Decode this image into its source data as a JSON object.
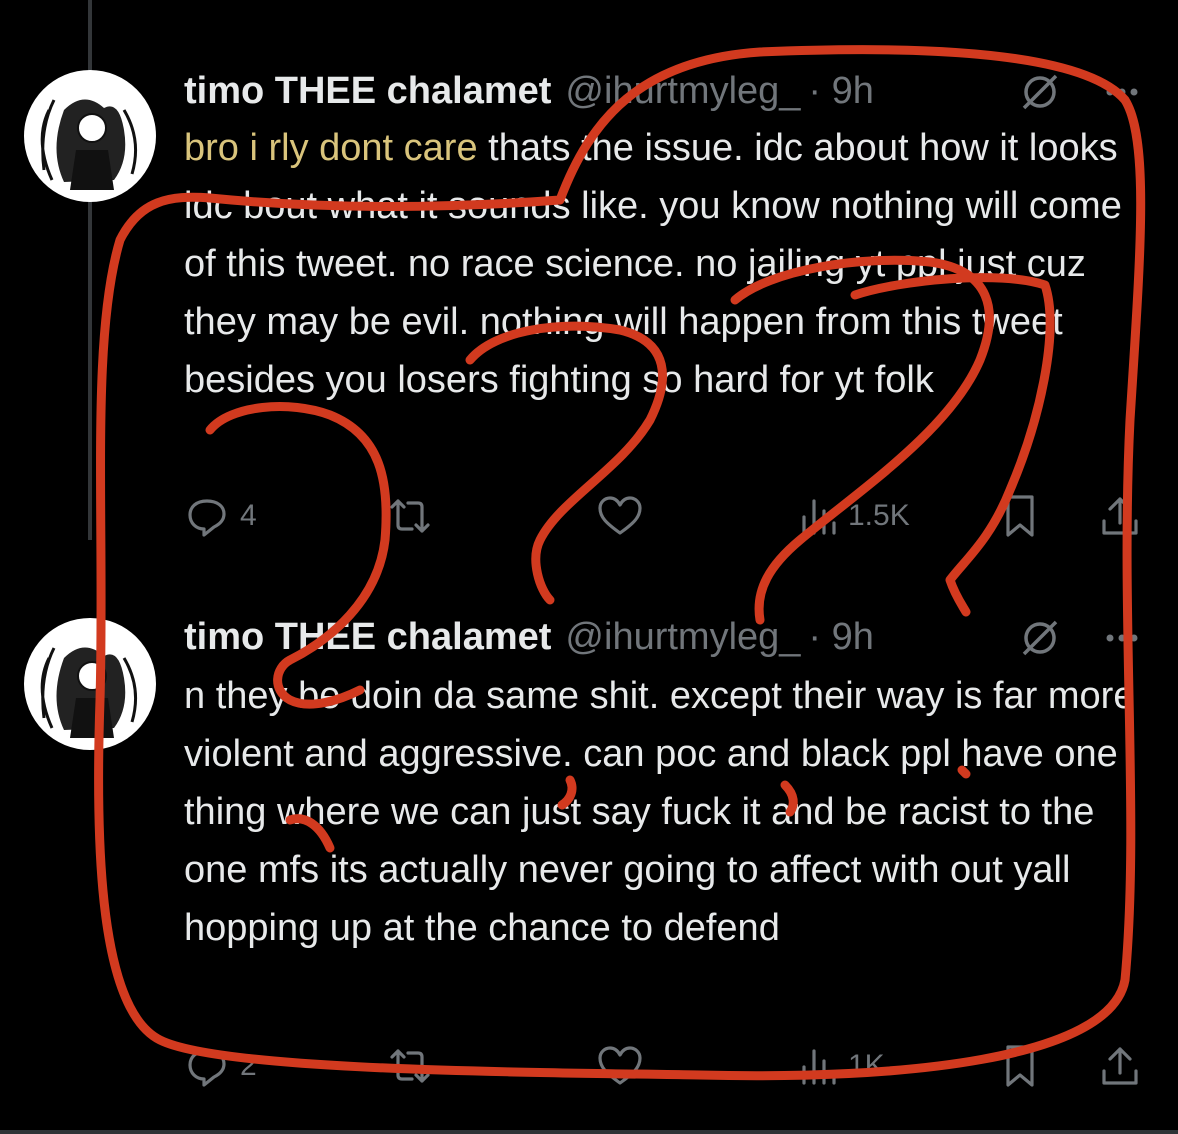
{
  "tweets": [
    {
      "name": "timo THEE chalamet",
      "handle": "@ihurtmyleg_",
      "time": "· 9h",
      "text_highlight": "bro i rly dont care",
      "text": " thats the issue. idc about how it looks idc bout what it sounds like. you know nothing will come of this tweet. no race science. no jailing yt ppl just cuz they may be evil. nothing will happen from this tweet besides you losers fighting so hard for yt folk",
      "replies": "4",
      "views": "1.5K"
    },
    {
      "name": "timo THEE chalamet",
      "handle": "@ihurtmyleg_",
      "time": "· 9h",
      "text": "n they be doin da same shit. except their way is far more violent and aggressive. can poc and black ppl have one thing where we can just say fuck it and be racist to the one mfs its actually never going to affect with out yall hopping up at the chance to defend",
      "replies": "2",
      "views": "1K"
    }
  ],
  "icons": [
    "reply-icon",
    "retweet-icon",
    "like-icon",
    "views-icon",
    "bookmark-icon",
    "share-icon",
    "grok-icon",
    "more-icon"
  ],
  "annotation_color": "#d23a1f"
}
